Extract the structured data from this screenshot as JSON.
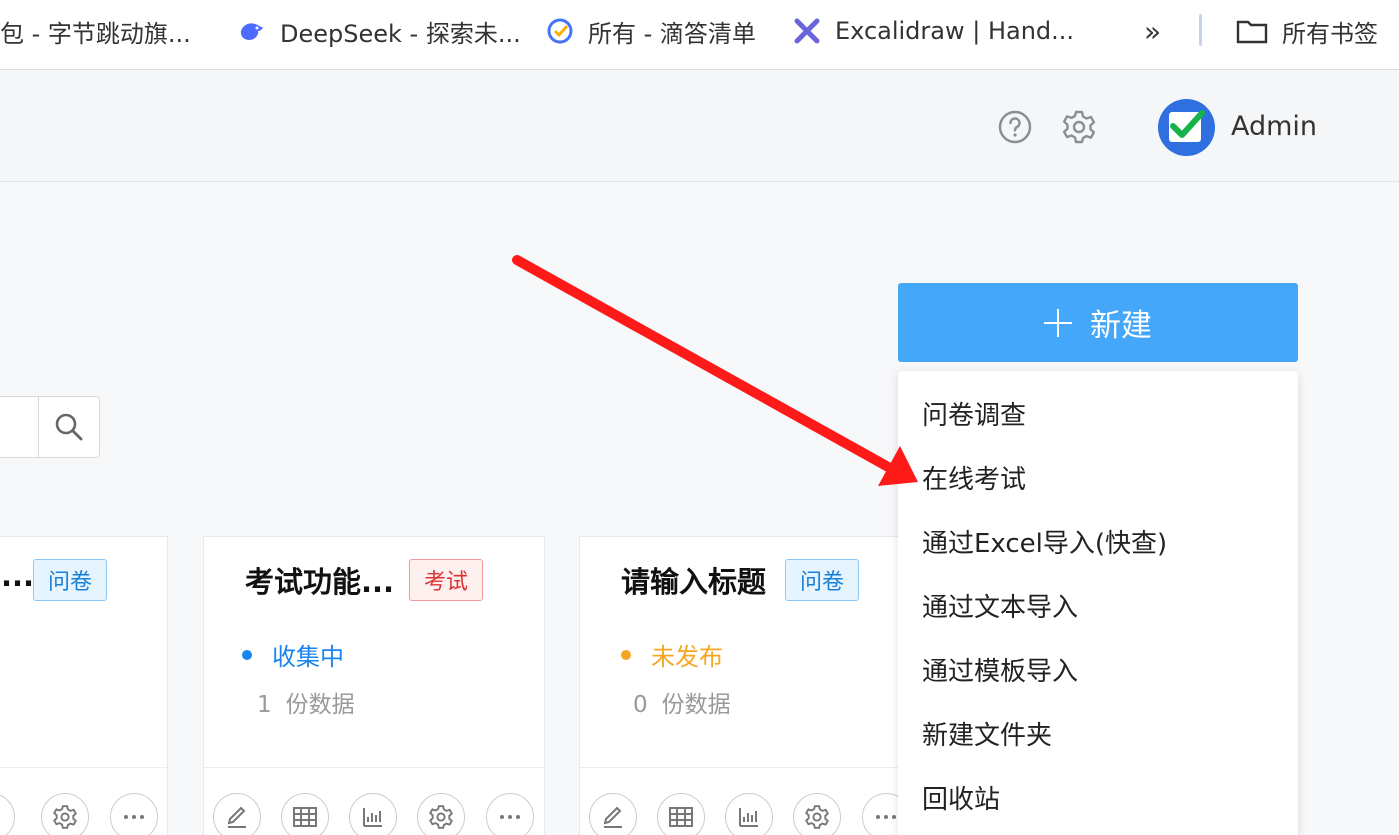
{
  "bookmarks": {
    "items": [
      {
        "label": "包 - 字节跳动旗...",
        "icon": "doubao-icon"
      },
      {
        "label": "DeepSeek - 探索未...",
        "icon": "deepseek-whale-icon"
      },
      {
        "label": "所有 - 滴答清单",
        "icon": "ticktick-check-icon"
      },
      {
        "label": "Excalidraw | Hand...",
        "icon": "excalidraw-pen-icon"
      }
    ],
    "overflow_label": "»",
    "all_bookmarks_label": "所有书签"
  },
  "header": {
    "user_name": "Admin"
  },
  "toolbar": {
    "new_label": "新建"
  },
  "new_menu": {
    "items": [
      "问卷调查",
      "在线考试",
      "通过Excel导入(快查)",
      "通过文本导入",
      "通过模板导入",
      "新建文件夹",
      "回收站"
    ]
  },
  "cards": [
    {
      "title": "...",
      "tag": "问卷"
    },
    {
      "title": "考试功能...",
      "tag": "考试",
      "status": "收集中",
      "count": "1",
      "count_label": "份数据"
    },
    {
      "title": "请输入标题",
      "tag": "问卷",
      "status": "未发布",
      "count": "0",
      "count_label": "份数据"
    }
  ],
  "colors": {
    "accent": "#44a7f9",
    "status_collecting": "#1a85f0",
    "status_unpublished": "#f5a623",
    "exam_tag": "#dd3333",
    "annotation_arrow": "#ff1a1a"
  }
}
